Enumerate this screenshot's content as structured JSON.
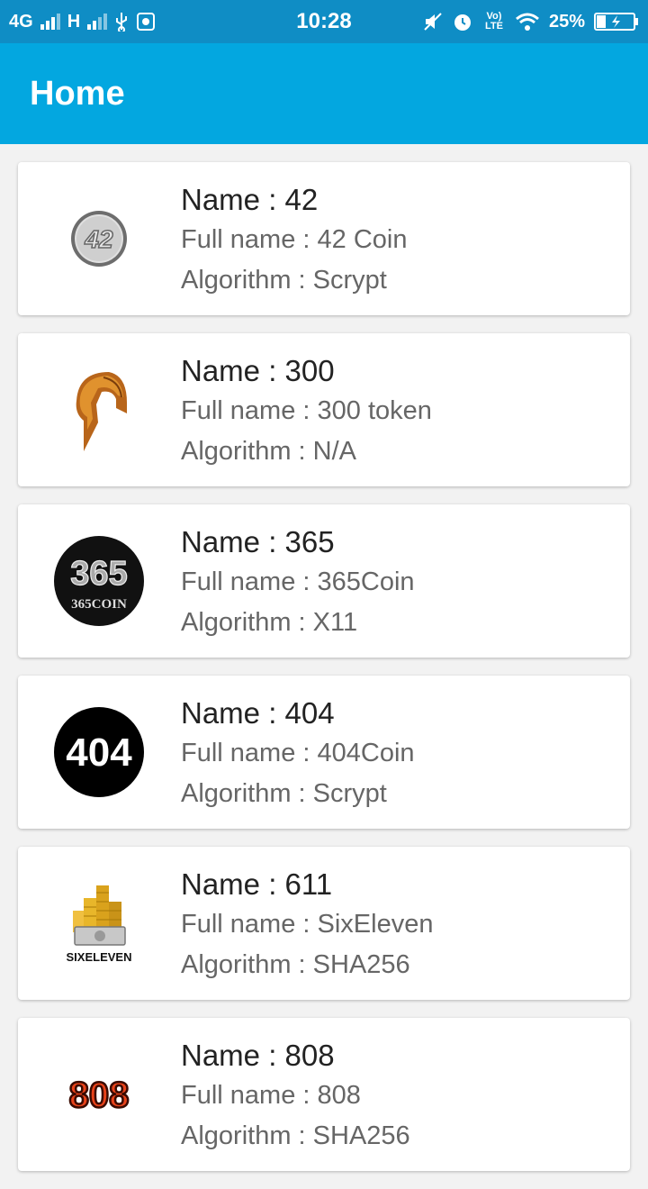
{
  "status_bar": {
    "network_1": "4G",
    "network_2": "H",
    "time": "10:28",
    "volte": "Vo) LTE",
    "battery": "25%"
  },
  "app_bar": {
    "title": "Home"
  },
  "coins": [
    {
      "name": "Name : 42",
      "full_name": "Full name : 42 Coin",
      "algorithm": "Algorithm : Scrypt",
      "logo_icon": "42-coin-logo-icon",
      "logo_text": "42"
    },
    {
      "name": "Name : 300",
      "full_name": "Full name : 300 token",
      "algorithm": "Algorithm : N/A",
      "logo_icon": "spartan-helmet-logo-icon"
    },
    {
      "name": "Name : 365",
      "full_name": "Full name : 365Coin",
      "algorithm": "Algorithm : X11",
      "logo_icon": "365coin-logo-icon",
      "logo_text": "365",
      "logo_subtext": "365COIN"
    },
    {
      "name": "Name : 404",
      "full_name": "Full name : 404Coin",
      "algorithm": "Algorithm : Scrypt",
      "logo_icon": "404coin-logo-icon",
      "logo_text": "404"
    },
    {
      "name": "Name : 611",
      "full_name": "Full name : SixEleven",
      "algorithm": "Algorithm : SHA256",
      "logo_icon": "sixeleven-logo-icon",
      "logo_text": "SIXELEVEN"
    },
    {
      "name": "Name : 808",
      "full_name": "Full name : 808",
      "algorithm": "Algorithm : SHA256",
      "logo_icon": "808-logo-icon",
      "logo_text": "808"
    }
  ],
  "colors": {
    "status_bar": "#0f8dc5",
    "app_bar": "#03a7e0",
    "background": "#f2f2f2"
  }
}
